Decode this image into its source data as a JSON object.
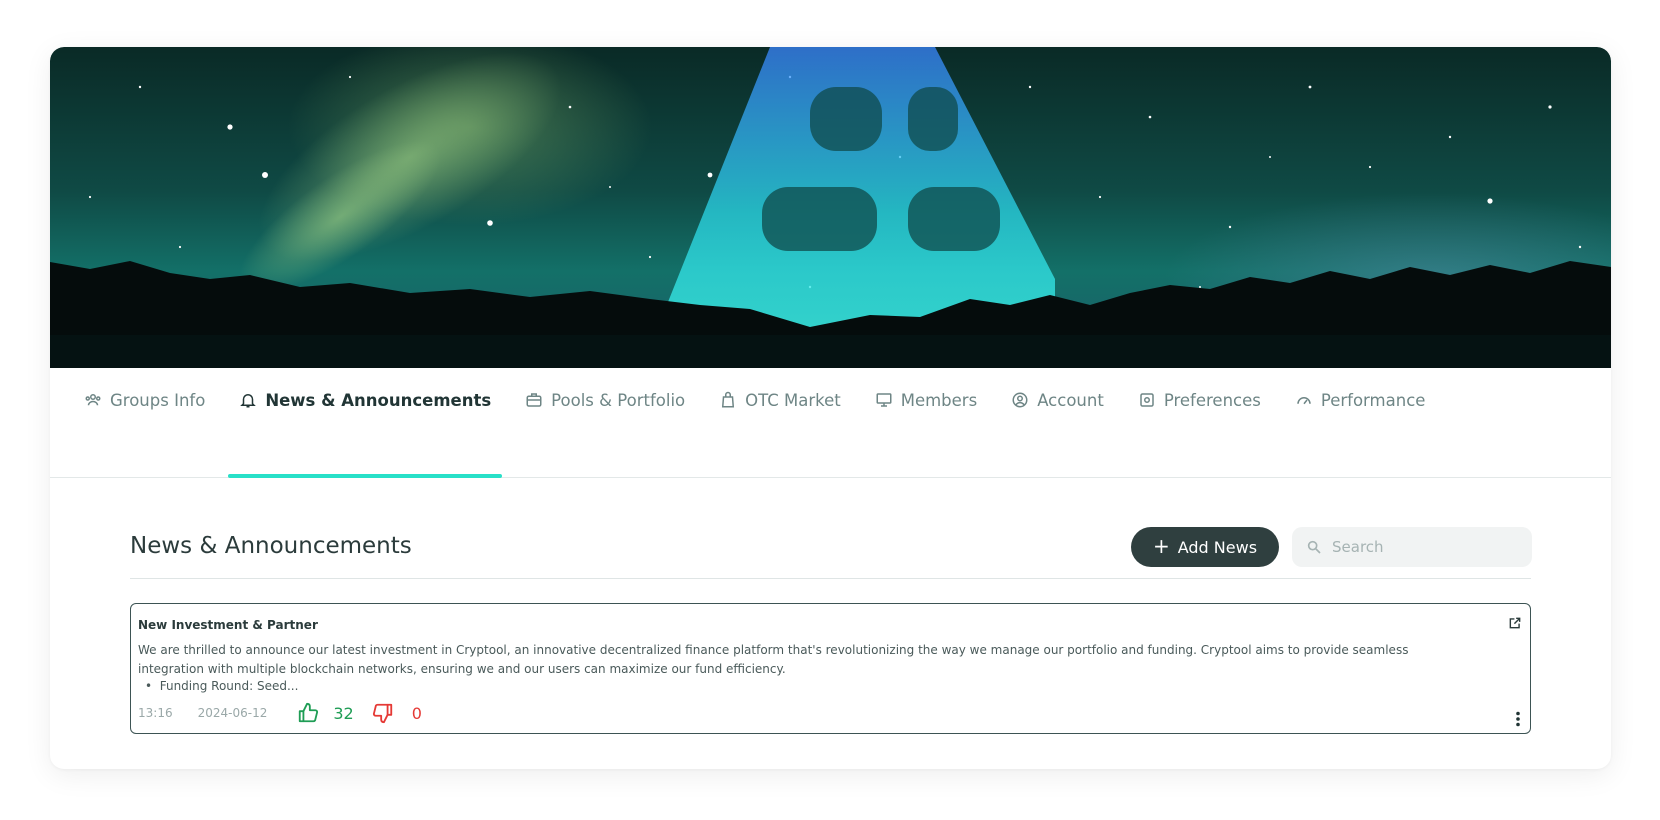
{
  "tabs": [
    {
      "label": "Groups Info",
      "icon": "users-icon",
      "active": false
    },
    {
      "label": "News & Announcements",
      "icon": "bell-icon",
      "active": true
    },
    {
      "label": "Pools & Portfolio",
      "icon": "briefcase-icon",
      "active": false
    },
    {
      "label": "OTC Market",
      "icon": "bag-icon",
      "active": false
    },
    {
      "label": "Members",
      "icon": "monitor-icon",
      "active": false
    },
    {
      "label": "Account",
      "icon": "account-circle-icon",
      "active": false
    },
    {
      "label": "Preferences",
      "icon": "settings-box-icon",
      "active": false
    },
    {
      "label": "Performance",
      "icon": "speedometer-icon",
      "active": false
    }
  ],
  "section": {
    "title": "News & Announcements",
    "add_button_label": "Add News",
    "search_placeholder": "Search"
  },
  "news": {
    "title": "New Investment & Partner",
    "body": "We are thrilled to announce our latest investment in Cryptool, an innovative decentralized finance platform that's revolutionizing the way we manage our portfolio and funding. Cryptool aims to provide seamless integration with multiple blockchain networks, ensuring we and our users can maximize our fund efficiency.",
    "bullet": "Funding Round: Seed...",
    "time": "13:16",
    "date": "2024-06-12",
    "likes": "32",
    "dislikes": "0"
  },
  "colors": {
    "accent": "#28e0c8",
    "button_dark": "#2f3f3f",
    "like": "#1f9d55",
    "dislike": "#e53935"
  }
}
